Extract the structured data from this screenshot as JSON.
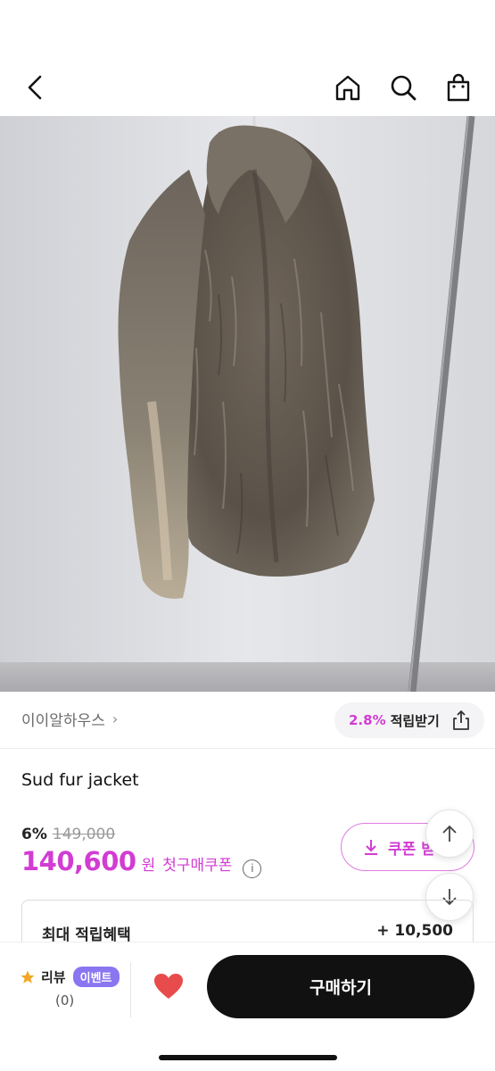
{
  "nav": {
    "back_icon": "chevron-left-icon",
    "home_icon": "home-icon",
    "search_icon": "search-icon",
    "bag_icon": "shopping-bag-icon"
  },
  "product_image": {
    "subject": "fur-jacket-photo"
  },
  "shop": {
    "name": "이이알하우스",
    "chevron": "›",
    "reward_percent": "2.8%",
    "reward_label": "적립받기",
    "share_icon": "share-icon"
  },
  "product": {
    "title": "Sud fur jacket",
    "discount_rate": "6%",
    "original_price": "149,000",
    "price": "140,600",
    "price_unit": "원",
    "price_label": "첫구매쿠폰",
    "info_icon": "i"
  },
  "coupon": {
    "label": "쿠폰 받",
    "icon": "download-icon"
  },
  "scroll": {
    "up_icon": "arrow-up-icon",
    "down_icon": "arrow-down-icon"
  },
  "benefit": {
    "label": "최대 적립혜택",
    "value": "+ 10,500"
  },
  "bottom": {
    "star_icon": "star-icon",
    "review_label": "리뷰",
    "event_badge": "이벤트",
    "review_count": "(0)",
    "heart_icon": "heart-icon",
    "buy_label": "구매하기"
  },
  "colors": {
    "accent": "#d23cd3",
    "event": "#8a76f0",
    "heart": "#e84b4b",
    "button": "#111111"
  }
}
